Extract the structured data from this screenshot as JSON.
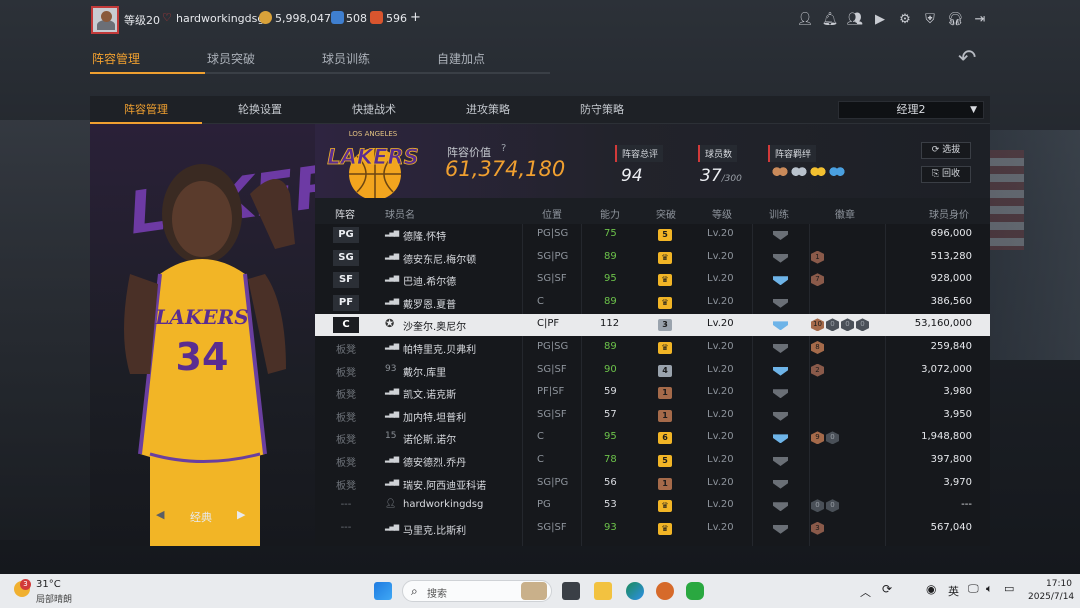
{
  "topbar": {
    "level": "等级20",
    "username": "hardworkingdsg",
    "gold": "5,998,047",
    "stars": "508",
    "diamonds": "596",
    "plus": "+"
  },
  "main_tabs": [
    "阵容管理",
    "球员突破",
    "球员训练",
    "自建加点"
  ],
  "sub_tabs": [
    "阵容管理",
    "轮换设置",
    "快捷战术",
    "进攻策略",
    "防守策略"
  ],
  "manager": {
    "label": "经理2"
  },
  "left_panel": {
    "jersey_number": "34",
    "jersey_team": "LAKERS",
    "bg_text": "LAKERS",
    "classic_label": "经典",
    "prev": "◀",
    "next": "▶"
  },
  "header": {
    "logo_top_text": "LOS ANGELES",
    "logo_text": "LAKERS",
    "team_value_label": "阵容价值",
    "team_value": "61,374,180",
    "rating_label": "阵容总评",
    "rating": "94",
    "count_label": "球员数",
    "count": "37",
    "count_max": "/300",
    "bond_label": "阵容羁绊",
    "select_btn": "选拔",
    "recycle_btn": "回收"
  },
  "table": {
    "columns": [
      "阵容",
      "球员名",
      "位置",
      "能力",
      "突破",
      "等级",
      "训练",
      "徽章",
      "球员身价"
    ],
    "rows": [
      {
        "slot": "PG",
        "name": "德隆.怀特",
        "pos": "PG|SG",
        "ability": "75",
        "breakthrough": "5",
        "level": "Lv.20",
        "value": "696,000",
        "badges": []
      },
      {
        "slot": "SG",
        "name": "德安东尼.梅尔顿",
        "pos": "SG|PG",
        "ability": "89",
        "breakthrough": "",
        "level": "Lv.20",
        "value": "513,280",
        "badges": [
          "1"
        ]
      },
      {
        "slot": "SF",
        "name": "巴迪.希尔德",
        "pos": "SG|SF",
        "ability": "95",
        "breakthrough": "",
        "level": "Lv.20",
        "value": "928,000",
        "badges": [
          "7"
        ]
      },
      {
        "slot": "PF",
        "name": "戴罗恩.夏普",
        "pos": "C",
        "ability": "89",
        "breakthrough": "",
        "level": "Lv.20",
        "value": "386,560",
        "badges": []
      },
      {
        "slot": "C",
        "name": "沙奎尔.奥尼尔",
        "pos": "C|PF",
        "ability": "112",
        "breakthrough": "3",
        "level": "Lv.20",
        "value": "53,160,000",
        "badges": [
          "10",
          "0",
          "0",
          "0"
        ]
      },
      {
        "slot": "板凳",
        "name": "帕特里克.贝弗利",
        "pos": "PG|SG",
        "ability": "89",
        "breakthrough": "",
        "level": "Lv.20",
        "value": "259,840",
        "badges": [
          "8"
        ]
      },
      {
        "slot": "板凳",
        "jersey": "93",
        "name": "戴尔.库里",
        "pos": "SG|SF",
        "ability": "90",
        "breakthrough": "4",
        "level": "Lv.20",
        "value": "3,072,000",
        "badges": [
          "2"
        ]
      },
      {
        "slot": "板凳",
        "name": "凯文.诺克斯",
        "pos": "PF|SF",
        "ability": "59",
        "breakthrough": "1",
        "level": "Lv.20",
        "value": "3,980",
        "badges": []
      },
      {
        "slot": "板凳",
        "name": "加内特.坦普利",
        "pos": "SG|SF",
        "ability": "57",
        "breakthrough": "1",
        "level": "Lv.20",
        "value": "3,950",
        "badges": []
      },
      {
        "slot": "板凳",
        "jersey": "15",
        "name": "诺伦斯.诺尔",
        "pos": "C",
        "ability": "95",
        "breakthrough": "6",
        "level": "Lv.20",
        "value": "1,948,800",
        "badges": [
          "9",
          "0"
        ]
      },
      {
        "slot": "板凳",
        "name": "德安德烈.乔丹",
        "pos": "C",
        "ability": "78",
        "breakthrough": "5",
        "level": "Lv.20",
        "value": "397,800",
        "badges": []
      },
      {
        "slot": "板凳",
        "name": "瑞安.阿西迪亚科诺",
        "pos": "SG|PG",
        "ability": "56",
        "breakthrough": "1",
        "level": "Lv.20",
        "value": "3,970",
        "badges": []
      },
      {
        "slot": "---",
        "name": "hardworkingdsg",
        "pos": "PG",
        "ability": "53",
        "breakthrough": "",
        "level": "Lv.20",
        "value": "---",
        "badges": [
          "0",
          "0"
        ]
      },
      {
        "slot": "---",
        "name": "马里克.比斯利",
        "pos": "SG|SF",
        "ability": "93",
        "breakthrough": "",
        "level": "Lv.20",
        "value": "567,040",
        "badges": [
          "3"
        ]
      }
    ]
  },
  "taskbar": {
    "weather_temp": "31°C",
    "weather_desc": "局部晴朗",
    "weather_badge": "3",
    "search_placeholder": "搜索",
    "lang": "英",
    "time": "17:10",
    "date": "2025/7/14"
  },
  "colors": {
    "accent": "#f0a030",
    "green": "#6cc24a",
    "purple": "#6a3fa0",
    "gold": "#f2b526"
  }
}
